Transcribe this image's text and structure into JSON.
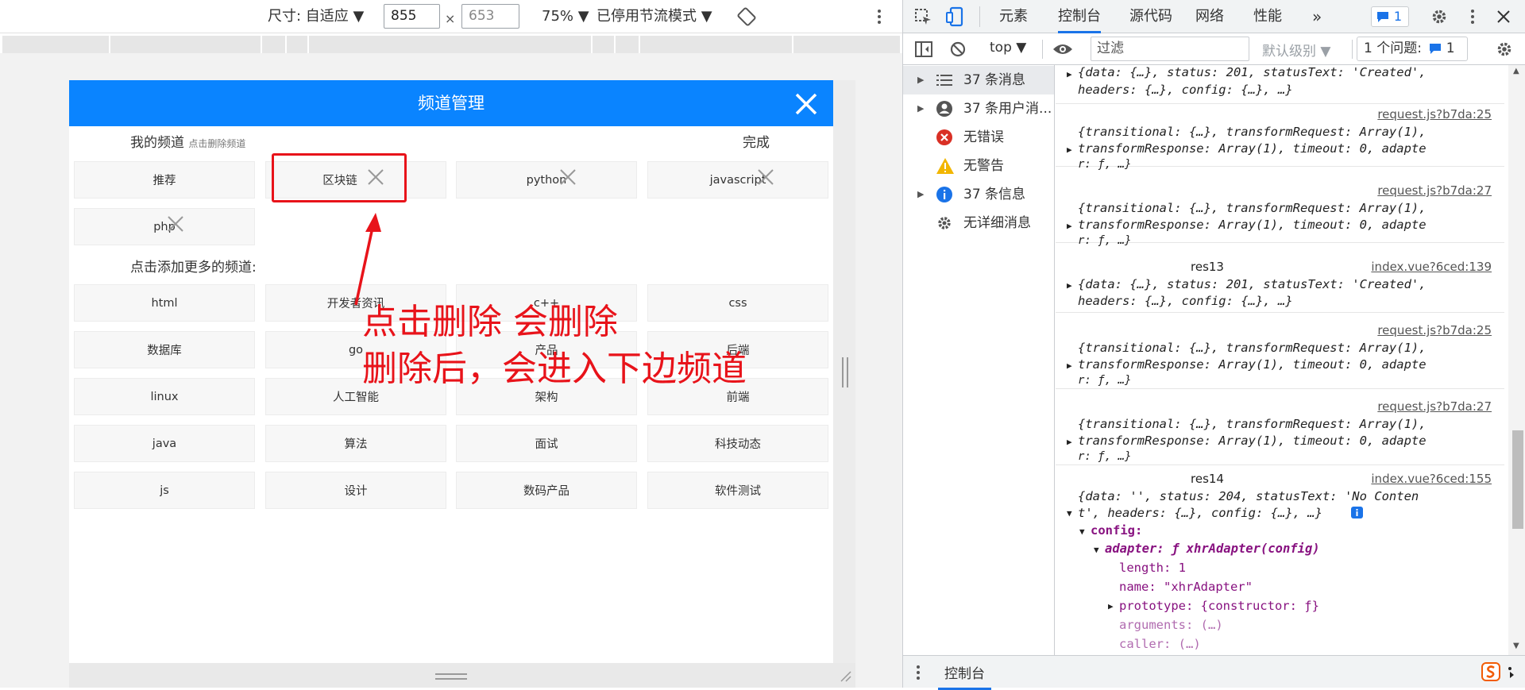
{
  "device_toolbar": {
    "dimensions_label": "尺寸: 自适应",
    "width_value": "855",
    "times_sign": "×",
    "height_placeholder": "653",
    "zoom": "75%",
    "throttle": "已停用节流模式"
  },
  "app": {
    "nav_title": "频道管理",
    "my_channels": {
      "label": "我的频道",
      "hint": "点击删除频道",
      "done": "完成",
      "items": [
        {
          "label": "推荐"
        },
        {
          "label": "区块链"
        },
        {
          "label": "python"
        },
        {
          "label": "javascript"
        },
        {
          "label": "php"
        }
      ]
    },
    "more_channels": {
      "label": "点击添加更多的频道:",
      "items": [
        {
          "label": "html"
        },
        {
          "label": "开发者资讯"
        },
        {
          "label": "c++"
        },
        {
          "label": "css"
        },
        {
          "label": "数据库"
        },
        {
          "label": "go"
        },
        {
          "label": "产品"
        },
        {
          "label": "后端"
        },
        {
          "label": "linux"
        },
        {
          "label": "人工智能"
        },
        {
          "label": "架构"
        },
        {
          "label": "前端"
        },
        {
          "label": "java"
        },
        {
          "label": "算法"
        },
        {
          "label": "面试"
        },
        {
          "label": "科技动态"
        },
        {
          "label": "js"
        },
        {
          "label": "设计"
        },
        {
          "label": "数码产品"
        },
        {
          "label": "软件测试"
        }
      ]
    }
  },
  "annotation": {
    "line1": "点击删除 会删除",
    "line2": "删除后，会进入下边频道",
    "color": "#e8131a"
  },
  "devtools": {
    "tabs": [
      "元素",
      "控制台",
      "源代码",
      "网络",
      "性能"
    ],
    "more": "»",
    "issue_badge": "1",
    "console_bar": {
      "context": "top",
      "filter_placeholder": "过滤",
      "level": "默认级别",
      "issues": "1 个问题:",
      "issues_count": "1"
    },
    "sidebar": [
      {
        "label": "37 条消息",
        "icon": "list-icon"
      },
      {
        "label": "37 条用户消...",
        "icon": "user-icon"
      },
      {
        "label": "无错误",
        "icon": "error-icon"
      },
      {
        "label": "无警告",
        "icon": "warning-icon"
      },
      {
        "label": "37 条信息",
        "icon": "info-icon"
      },
      {
        "label": "无详细消息",
        "icon": "gear-icon"
      }
    ],
    "log": {
      "e0_line1": "{data: {…}, status: 201, statusText: 'Created',",
      "e0_line2": "headers: {…}, config: {…}, …}",
      "src_b7da_25": "request.js?b7da:25",
      "src_b7da_27": "request.js?b7da:27",
      "interceptor_line1": "{transitional: {…}, transformRequest: Array(1),",
      "interceptor_line2": "transformResponse: Array(1), timeout: 0, adapte",
      "interceptor_line3": "r: ƒ, …}",
      "res13_label": "res13",
      "src_139": "index.vue?6ced:139",
      "res13_line1": "{data: {…}, status: 201, statusText: 'Created',",
      "res13_line2": "headers: {…}, config: {…}, …}",
      "res14_label": "res14",
      "src_155": "index.vue?6ced:155",
      "res14_line1": "{data: '', status: 204, statusText: 'No Conten",
      "res14_line2": "t', headers: {…}, config: {…}, …}",
      "config_key": "config:",
      "adapter_line": "adapter: ƒ xhrAdapter(config)",
      "length_line": "length: 1",
      "name_line": "name: \"xhrAdapter\"",
      "prototype_line": "prototype: {constructor: ƒ}",
      "arguments_line": "arguments: (…)",
      "caller_line": "caller: (…)"
    },
    "drawer_tab": "控制台"
  }
}
